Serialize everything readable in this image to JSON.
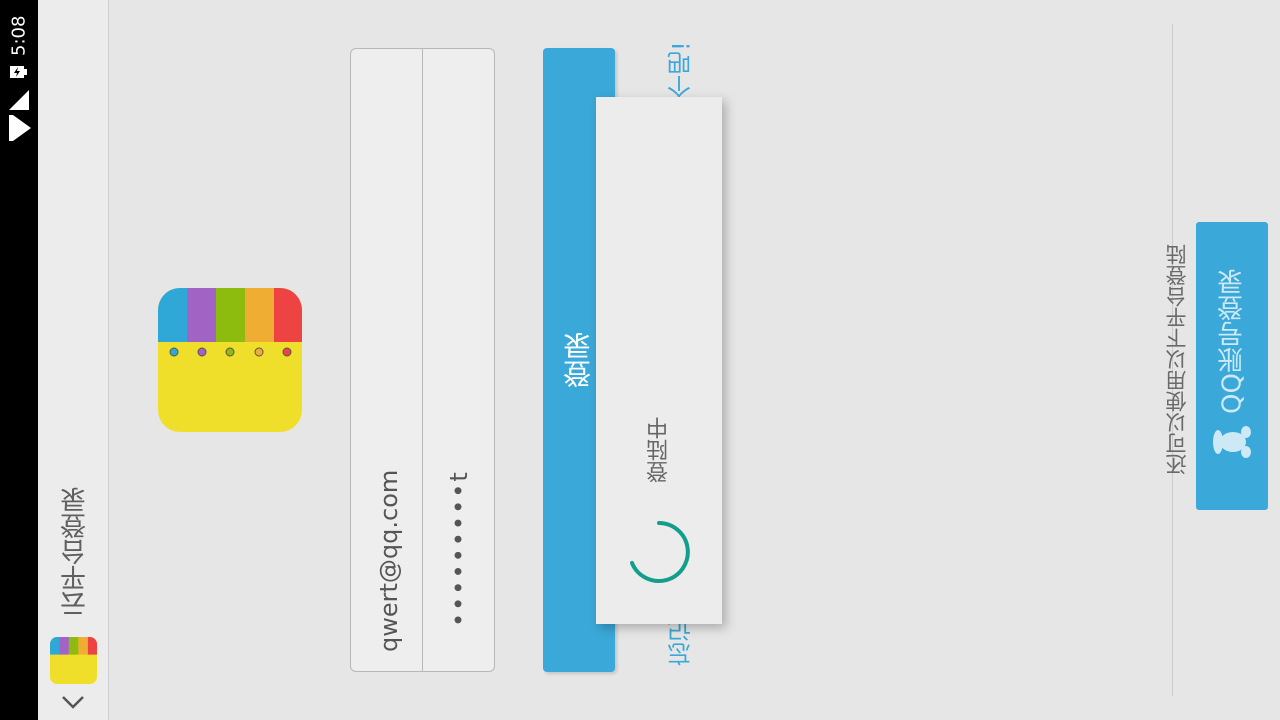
{
  "status_bar": {
    "time": "5:08",
    "icons": [
      "battery-charging-icon",
      "signal-icon",
      "wifi-icon"
    ]
  },
  "toolbar": {
    "title": "云平台登录",
    "app_icon": "app-logo-icon",
    "back_icon": "chevron-icon"
  },
  "form": {
    "email_value": "qwert@qq.com",
    "password_value": "•••••••••t",
    "login_label": "登录",
    "register_link": "个吧!",
    "forgot_link": "忘记"
  },
  "dialog": {
    "message": "登陆中",
    "spinner_icon": "loading-spinner-icon"
  },
  "other_login": {
    "prompt": "还可以使用以下平台登陆",
    "qq_label": "QQ账号登录",
    "qq_icon": "qq-penguin-icon"
  },
  "colors": {
    "accent": "#3aa8d8",
    "background": "#e6e6e6",
    "spinner": "#139e8c",
    "logo_stripes": [
      "#2fa8d8",
      "#a163c4",
      "#8dbb0e",
      "#f0ad33",
      "#ee4343"
    ],
    "logo_body": "#efdf2a"
  }
}
